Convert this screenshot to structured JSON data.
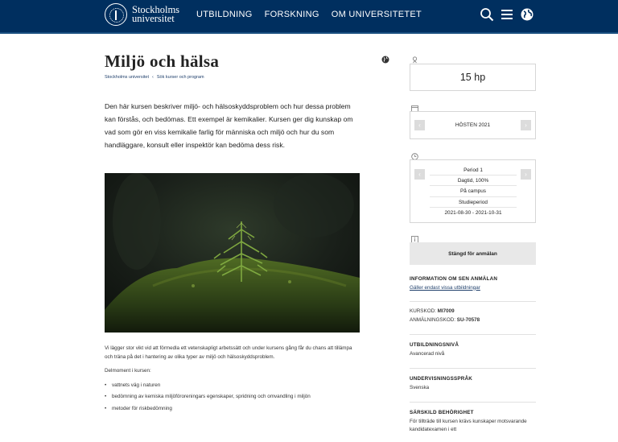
{
  "header": {
    "logo_line1": "Stockholms",
    "logo_line2": "universitet",
    "nav": [
      "UTBILDNING",
      "FORSKNING",
      "OM UNIVERSITETET"
    ],
    "icons": [
      "search-icon",
      "menu-icon",
      "globe-icon"
    ]
  },
  "page": {
    "title": "Miljö och hälsa",
    "breadcrumb": [
      "Stockholms universitet",
      "Sök kurser och program"
    ],
    "breadcrumb_sep": "‹",
    "intro": "Den här kursen beskriver miljö- och hälsoskyddsproblem och hur dessa problem kan förstås, och bedömas. Ett exempel är kemikalier. Kursen ger dig kunskap om vad som gör en viss kemikalie farlig för människa och miljö och hur du som handläggare, konsult eller inspektör kan bedöma dess risk.",
    "photo_alt": "Närbild på en liten gran som växer i mossa",
    "paragraph": "Vi lägger stor vikt vid att förmedla ett vetenskapligt arbetssätt och under kursens gång får du chans att tillämpa och träna på det i hantering av olika typer av miljö och hälsoskyddsproblem.",
    "list_intro": "Delmoment i kursen:",
    "list": [
      "vattnets väg i naturen",
      "bedömning av kemiska miljöföroreningars egenskaper, spridning och omvandling i miljön",
      "metoder för riskbedömning"
    ]
  },
  "sidebar": {
    "credits": "15 hp",
    "term": "HÖSTEN 2021",
    "period": [
      "Period 1",
      "Dagtid, 100%",
      "På campus",
      "Studieperiod",
      "2021-08-30 - 2021-10-31"
    ],
    "status_button": "Stängd för anmälan",
    "late_heading": "INFORMATION OM SEN ANMÄLAN",
    "late_link": "Gäller endast vissa utbildningar",
    "course_code_label": "KURSKOD:",
    "course_code": "MI7009",
    "app_code_label": "ANMÄLNINGSKOD:",
    "app_code": "SU-70578",
    "level_heading": "UTBILDNINGSNIVÅ",
    "level": "Avancerad nivå",
    "lang_heading": "UNDERVISNINGSSPRÅK",
    "lang": "Svenska",
    "req_heading": "SÄRSKILD BEHÖRIGHET",
    "req_text": "För tillträde till kursen krävs kunskaper motsvarande kandidatexamen i ett"
  },
  "colors": {
    "header_bg": "#002f5f",
    "link": "#1f3f6b",
    "button_bg": "#e8e8e8"
  }
}
